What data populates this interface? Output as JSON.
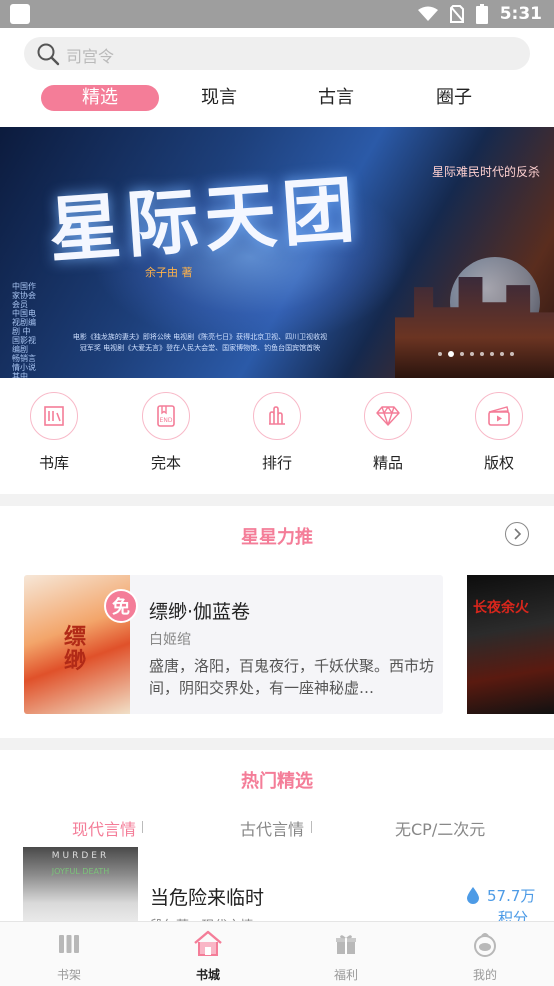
{
  "status_bar": {
    "time": "5:31"
  },
  "search": {
    "placeholder": "司宫令"
  },
  "tabs": [
    {
      "label": "精选",
      "active": true
    },
    {
      "label": "现言",
      "active": false
    },
    {
      "label": "古言",
      "active": false
    },
    {
      "label": "圈子",
      "active": false
    }
  ],
  "banner": {
    "title": "星际天团",
    "author": "余子由 著",
    "tagline": "星际难民时代的反杀",
    "blurb": "电影《独龙族的妻夫》即将公映 电视剧《陈亮七日》获得北京卫视、四川卫视收视冠军奖 电视剧《大爱无言》登在人民大会堂、国家博物馆、钓鱼台国宾馆首映",
    "side_text": "中国作家协会会员 中国电视剧编剧 中国影视编剧 畅销言情小说 其中 主持人",
    "slide_count": 8,
    "active_slide": 1
  },
  "quick_links": [
    {
      "label": "书库",
      "icon": "library-icon"
    },
    {
      "label": "完本",
      "icon": "finished-book-icon"
    },
    {
      "label": "排行",
      "icon": "ranking-icon"
    },
    {
      "label": "精品",
      "icon": "diamond-icon"
    },
    {
      "label": "版权",
      "icon": "copyright-film-icon"
    }
  ],
  "recommend": {
    "title": "星星力推",
    "free_badge": "免",
    "cover_text": "缥缈",
    "book": {
      "name": "缥缈·伽蓝卷",
      "author": "白姬绾",
      "desc": "盛唐，洛阳，百鬼夜行，千妖伏聚。西市坊间，阴阳交界处，有一座神秘虚…"
    },
    "second_cover_text": "长夜余火"
  },
  "hot": {
    "title": "热门精选",
    "subtabs": [
      {
        "label": "现代言情",
        "active": true
      },
      {
        "label": "古代言情",
        "active": false
      },
      {
        "label": "无CP/二次元",
        "active": false
      }
    ],
    "cover_text": "MURDER",
    "cover_subtext": "JOYFUL DEATH",
    "book": {
      "name": "当危险来临时",
      "meta": "段尔萱 · 现代言情",
      "score": "57.7万",
      "score_unit": "积分"
    }
  },
  "bottom_nav": [
    {
      "label": "书架",
      "icon": "bookshelf-icon",
      "active": false
    },
    {
      "label": "书城",
      "icon": "bookstore-home-icon",
      "active": true
    },
    {
      "label": "福利",
      "icon": "gift-icon",
      "active": false
    },
    {
      "label": "我的",
      "icon": "profile-icon",
      "active": false
    }
  ],
  "colors": {
    "accent": "#f47d98",
    "status_bar": "#9e9e9e",
    "score_blue": "#4d9be6"
  }
}
